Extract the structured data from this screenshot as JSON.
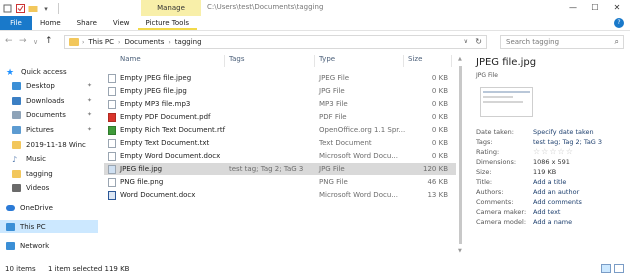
{
  "window": {
    "context_tab": "Manage",
    "title_path": "C:\\Users\\test\\Documents\\tagging",
    "minimize": "—",
    "maximize": "☐",
    "close": "✕"
  },
  "ribbon": {
    "tabs": [
      "File",
      "Home",
      "Share",
      "View",
      "Picture Tools"
    ],
    "help": "?"
  },
  "address": {
    "back": "←",
    "forward": "→",
    "recent": "∨",
    "up": "↑",
    "segments": [
      "This PC",
      "Documents",
      "tagging"
    ],
    "search_placeholder": "Search tagging"
  },
  "sidebar": {
    "items": [
      {
        "label": "Quick access",
        "color": "#1e90ff"
      },
      {
        "label": "Desktop",
        "color": "#3b8fd6"
      },
      {
        "label": "Downloads",
        "color": "#3b7fc4"
      },
      {
        "label": "Documents",
        "color": "#8ea3b8"
      },
      {
        "label": "Pictures",
        "color": "#5c9bd1"
      },
      {
        "label": "2019-11-18 Winc",
        "color": "#f2c75c"
      },
      {
        "label": "Music",
        "color": "#5a7fb0"
      },
      {
        "label": "tagging",
        "color": "#f2c75c"
      },
      {
        "label": "Videos",
        "color": "#6a6a6a"
      },
      {
        "label": "OneDrive",
        "color": "#2b7ad6"
      },
      {
        "label": "This PC",
        "color": "#3b8fd6"
      },
      {
        "label": "Network",
        "color": "#3b8fd6"
      }
    ]
  },
  "columns": {
    "name": "Name",
    "tags": "Tags",
    "type": "Type",
    "size": "Size"
  },
  "files": [
    {
      "name": "Empty JPEG file.jpeg",
      "tags": "",
      "type": "JPEG File",
      "size": "0 KB",
      "icon_color": "#ffffff"
    },
    {
      "name": "Empty JPEG file.jpg",
      "tags": "",
      "type": "JPG File",
      "size": "0 KB",
      "icon_color": "#ffffff"
    },
    {
      "name": "Empty MP3 file.mp3",
      "tags": "",
      "type": "MP3 File",
      "size": "0 KB",
      "icon_color": "#ffffff"
    },
    {
      "name": "Empty PDF Document.pdf",
      "tags": "",
      "type": "PDF File",
      "size": "0 KB",
      "icon_color": "#d9342b"
    },
    {
      "name": "Empty Rich Text Document.rtf",
      "tags": "",
      "type": "OpenOffice.org 1.1 Spr...",
      "size": "0 KB",
      "icon_color": "#3f9b3a"
    },
    {
      "name": "Empty Text Document.txt",
      "tags": "",
      "type": "Text Document",
      "size": "0 KB",
      "icon_color": "#ffffff"
    },
    {
      "name": "Empty Word Document.docx",
      "tags": "",
      "type": "Microsoft Word Docu...",
      "size": "0 KB",
      "icon_color": "#ffffff"
    },
    {
      "name": "JPEG file.jpg",
      "tags": "test tag; Tag 2; TaG 3",
      "type": "JPG File",
      "size": "120 KB",
      "icon_color": "#ffffff",
      "selected": true
    },
    {
      "name": "PNG file.png",
      "tags": "",
      "type": "PNG File",
      "size": "46 KB",
      "icon_color": "#ffffff"
    },
    {
      "name": "Word Document.docx",
      "tags": "",
      "type": "Microsoft Word Docu...",
      "size": "13 KB",
      "icon_color": "#2b5797"
    }
  ],
  "details": {
    "title": "JPEG file.jpg",
    "subtitle": "JPG File",
    "props": [
      {
        "k": "Date taken:",
        "v": "Specify date taken"
      },
      {
        "k": "Tags:",
        "v": "test tag; Tag 2; TaG 3"
      },
      {
        "k": "Rating:",
        "v": "☆☆☆☆☆"
      },
      {
        "k": "Dimensions:",
        "v": "1086 x 591"
      },
      {
        "k": "Size:",
        "v": "119 KB"
      },
      {
        "k": "Title:",
        "v": "Add a title"
      },
      {
        "k": "Authors:",
        "v": "Add an author"
      },
      {
        "k": "Comments:",
        "v": "Add comments"
      },
      {
        "k": "Camera maker:",
        "v": "Add text"
      },
      {
        "k": "Camera model:",
        "v": "Add a name"
      }
    ]
  },
  "status": {
    "count": "10 items",
    "selection": "1 item selected  119 KB"
  },
  "colors": {
    "accent": "#1979ca",
    "manage_tab": "#f8efa9",
    "selection_row": "#d9d9d9",
    "nav_selected": "#cce8ff"
  }
}
